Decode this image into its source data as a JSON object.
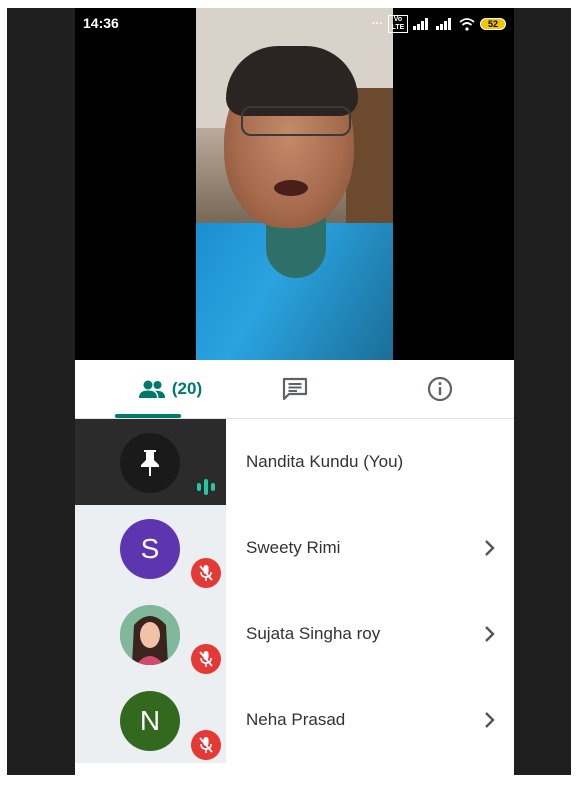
{
  "status_bar": {
    "time": "14:36",
    "network": "Vo LTE",
    "battery": "52"
  },
  "tabs": {
    "people_count": "(20)",
    "people_icon": "people-icon",
    "chat_icon": "chat-icon",
    "info_icon": "info-icon",
    "active": "people"
  },
  "participants": [
    {
      "name": "Nandita Kundu (You)",
      "avatar": "pin-icon",
      "status": "speaking"
    },
    {
      "name": "Sweety Rimi",
      "avatar_letter": "S",
      "avatar_color": "#5e35b1",
      "status": "muted"
    },
    {
      "name": "Sujata Singha roy",
      "avatar": "photo",
      "status": "muted"
    },
    {
      "name": "Neha Prasad",
      "avatar_letter": "N",
      "avatar_color": "#33691e",
      "status": "muted"
    }
  ],
  "colors": {
    "accent": "#00796b",
    "mute_badge": "#e53935",
    "speaking": "#26c6a0"
  }
}
